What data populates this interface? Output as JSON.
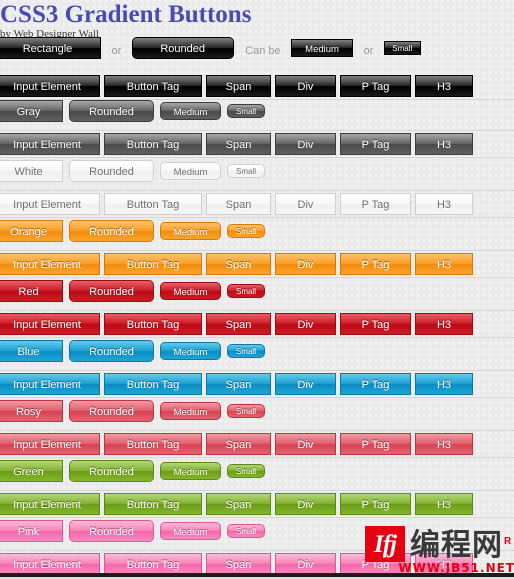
{
  "header": {
    "title": "CSS3 Gradient Buttons",
    "byline": "by Web Designer Wall"
  },
  "intro_row": {
    "rectangle_label": "Rectangle",
    "or_1": "or",
    "rounded_label": "Rounded",
    "can_be": "Can be",
    "medium_label": "Medium",
    "or_2": "or",
    "small_label": "Small"
  },
  "demo_labels": {
    "input_element": "Input Element",
    "button_tag": "Button Tag",
    "span": "Span",
    "div": "Div",
    "p_tag": "P Tag",
    "h3": "H3"
  },
  "size_labels": {
    "rounded": "Rounded",
    "medium": "Medium",
    "small": "Small"
  },
  "color_sections": [
    {
      "name": "Gray",
      "theme": "gray",
      "accent": "#5d5d5d"
    },
    {
      "name": "White",
      "theme": "white",
      "accent": "#f3f3f3"
    },
    {
      "name": "Orange",
      "theme": "orange",
      "accent": "#f79a1e"
    },
    {
      "name": "Red",
      "theme": "red",
      "accent": "#c9101c"
    },
    {
      "name": "Blue",
      "theme": "blue",
      "accent": "#109cd0"
    },
    {
      "name": "Rosy",
      "theme": "rosy",
      "accent": "#e05666"
    },
    {
      "name": "Green",
      "theme": "green",
      "accent": "#7cae28"
    },
    {
      "name": "Pink",
      "theme": "pink",
      "accent": "#f77cb5"
    }
  ],
  "watermark": {
    "badge_glyph": "Ifj",
    "name": "编程网",
    "registered": "R",
    "url": "WWW.JB51.NET",
    "badge_color": "#e60012",
    "url_color": "#e60012"
  }
}
